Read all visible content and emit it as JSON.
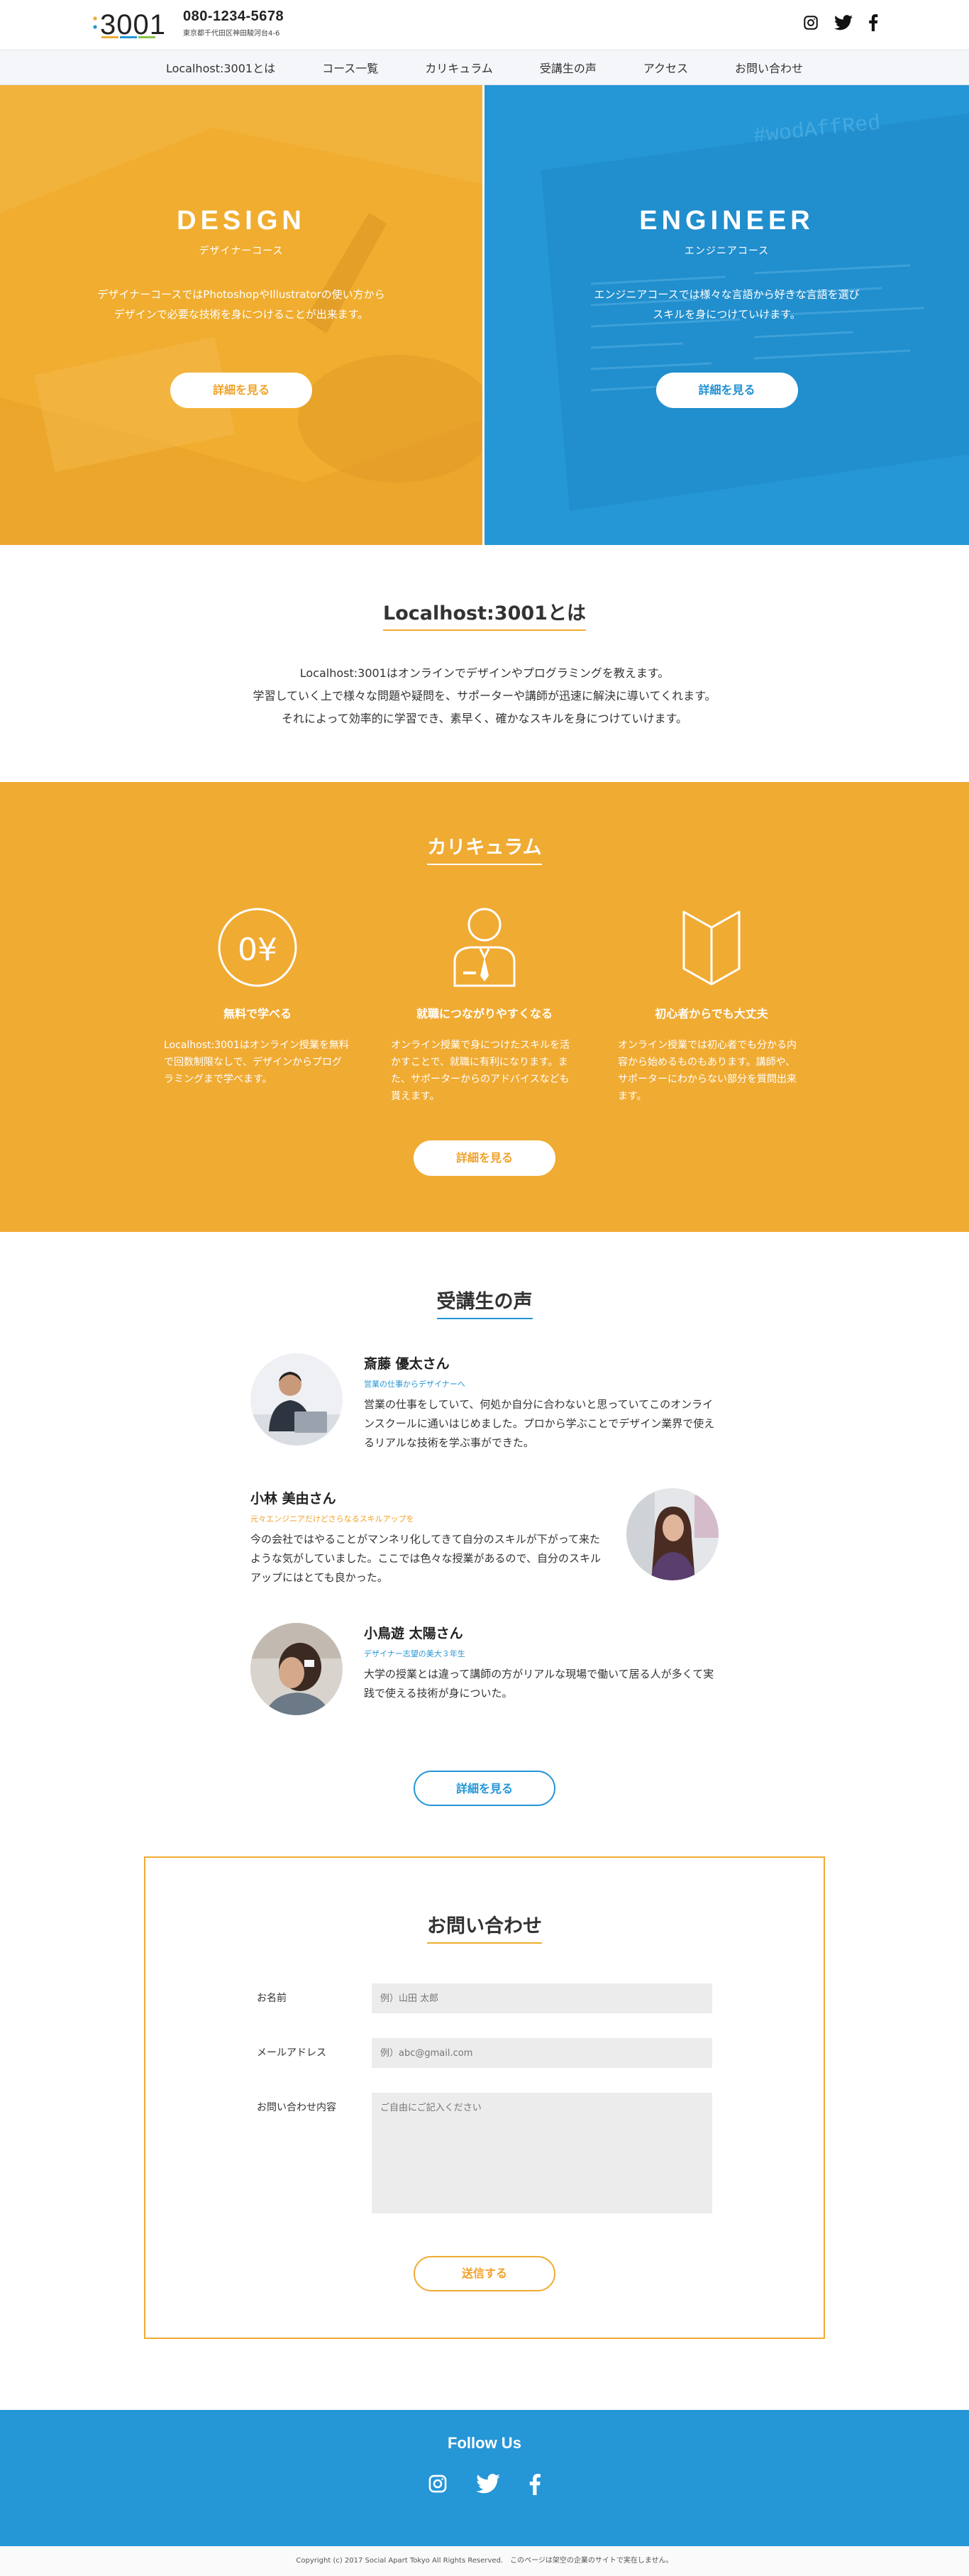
{
  "header": {
    "logo_text": ":3001",
    "tel": "080-1234-5678",
    "address": "東京都千代田区神田駿河台4-6",
    "social": [
      "instagram-icon",
      "twitter-icon",
      "facebook-icon"
    ]
  },
  "nav": {
    "items": [
      {
        "label": "Localhost:3001とは"
      },
      {
        "label": "コース一覧"
      },
      {
        "label": "カリキュラム"
      },
      {
        "label": "受講生の声"
      },
      {
        "label": "アクセス"
      },
      {
        "label": "お問い合わせ"
      }
    ]
  },
  "hero": {
    "design": {
      "title": "DESIGN",
      "subtitle": "デザイナーコース",
      "desc_line1": "デザイナーコースではPhotoshopやIllustratorの使い方から",
      "desc_line2": "デザインで必要な技術を身につけることが出来ます。",
      "button": "詳細を見る"
    },
    "engineer": {
      "title": "ENGINEER",
      "subtitle": "エンジニアコース",
      "desc_line1": "エンジニアコースでは様々な言語から好きな言語を選び",
      "desc_line2": "スキルを身につけていけます。",
      "button": "詳細を見る"
    }
  },
  "about": {
    "title": "Localhost:3001とは",
    "line1": "Localhost:3001はオンラインでデザインやプログラミングを教えます。",
    "line2": "学習していく上で様々な問題や疑問を、サポーターや講師が迅速に解決に導いてくれます。",
    "line3": "それによって効率的に学習でき、素早く、確かなスキルを身につけていけます。"
  },
  "curriculum": {
    "title": "カリキュラム",
    "items": [
      {
        "icon": "zero-yen-icon",
        "name": "無料で学べる",
        "desc": "Localhost:3001はオンライン授業を無料で回数制限なしで、デザインからプログラミングまで学べます。"
      },
      {
        "icon": "businessman-icon",
        "name": "就職につながりやすくなる",
        "desc": "オンライン授業で身につけたスキルを活かすことで、就職に有利になります。また、サポーターからのアドバイスなども貰えます。"
      },
      {
        "icon": "book-icon",
        "name": "初心者からでも大丈夫",
        "desc": "オンライン授業では初心者でも分かる内容から始めるものもあります。講師や、サポーターにわからない部分を質問出来ます。"
      }
    ],
    "button": "詳細を見る"
  },
  "voices": {
    "title": "受講生の声",
    "items": [
      {
        "name": "斎藤 優太さん",
        "tag": "営業の仕事からデザイナーへ",
        "body": "営業の仕事をしていて、何処か自分に合わないと思っていてこのオンラインスクールに通いはじめました。プロから学ぶことでデザイン業界で使えるリアルな技術を学ぶ事ができた。"
      },
      {
        "name": "小林 美由さん",
        "tag": "元々エンジニアだけどさらなるスキルアップを",
        "body": "今の会社ではやることがマンネリ化してきて自分のスキルが下がって来たような気がしていました。ここでは色々な授業があるので、自分のスキルアップにはとても良かった。"
      },
      {
        "name": "小鳥遊 太陽さん",
        "tag": "デザイナー志望の美大３年生",
        "body": "大学の授業とは違って講師の方がリアルな現場で働いて居る人が多くて実践で使える技術が身についた。"
      }
    ],
    "button": "詳細を見る"
  },
  "contact": {
    "title": "お問い合わせ",
    "name_label": "お名前",
    "name_placeholder": "例）山田 太郎",
    "email_label": "メールアドレス",
    "email_placeholder": "例）abc@gmail.com",
    "message_label": "お問い合わせ内容",
    "message_placeholder": "ご自由にご記入ください",
    "submit": "送信する"
  },
  "footer": {
    "follow": "Follow Us",
    "copyright": "Copyright (c) 2017 Social Apart Tokyo All Rights Reserved.　このページは架空の企業のサイトで実在しません。"
  },
  "colors": {
    "orange": "#f0ab33",
    "blue": "#2596d6"
  }
}
